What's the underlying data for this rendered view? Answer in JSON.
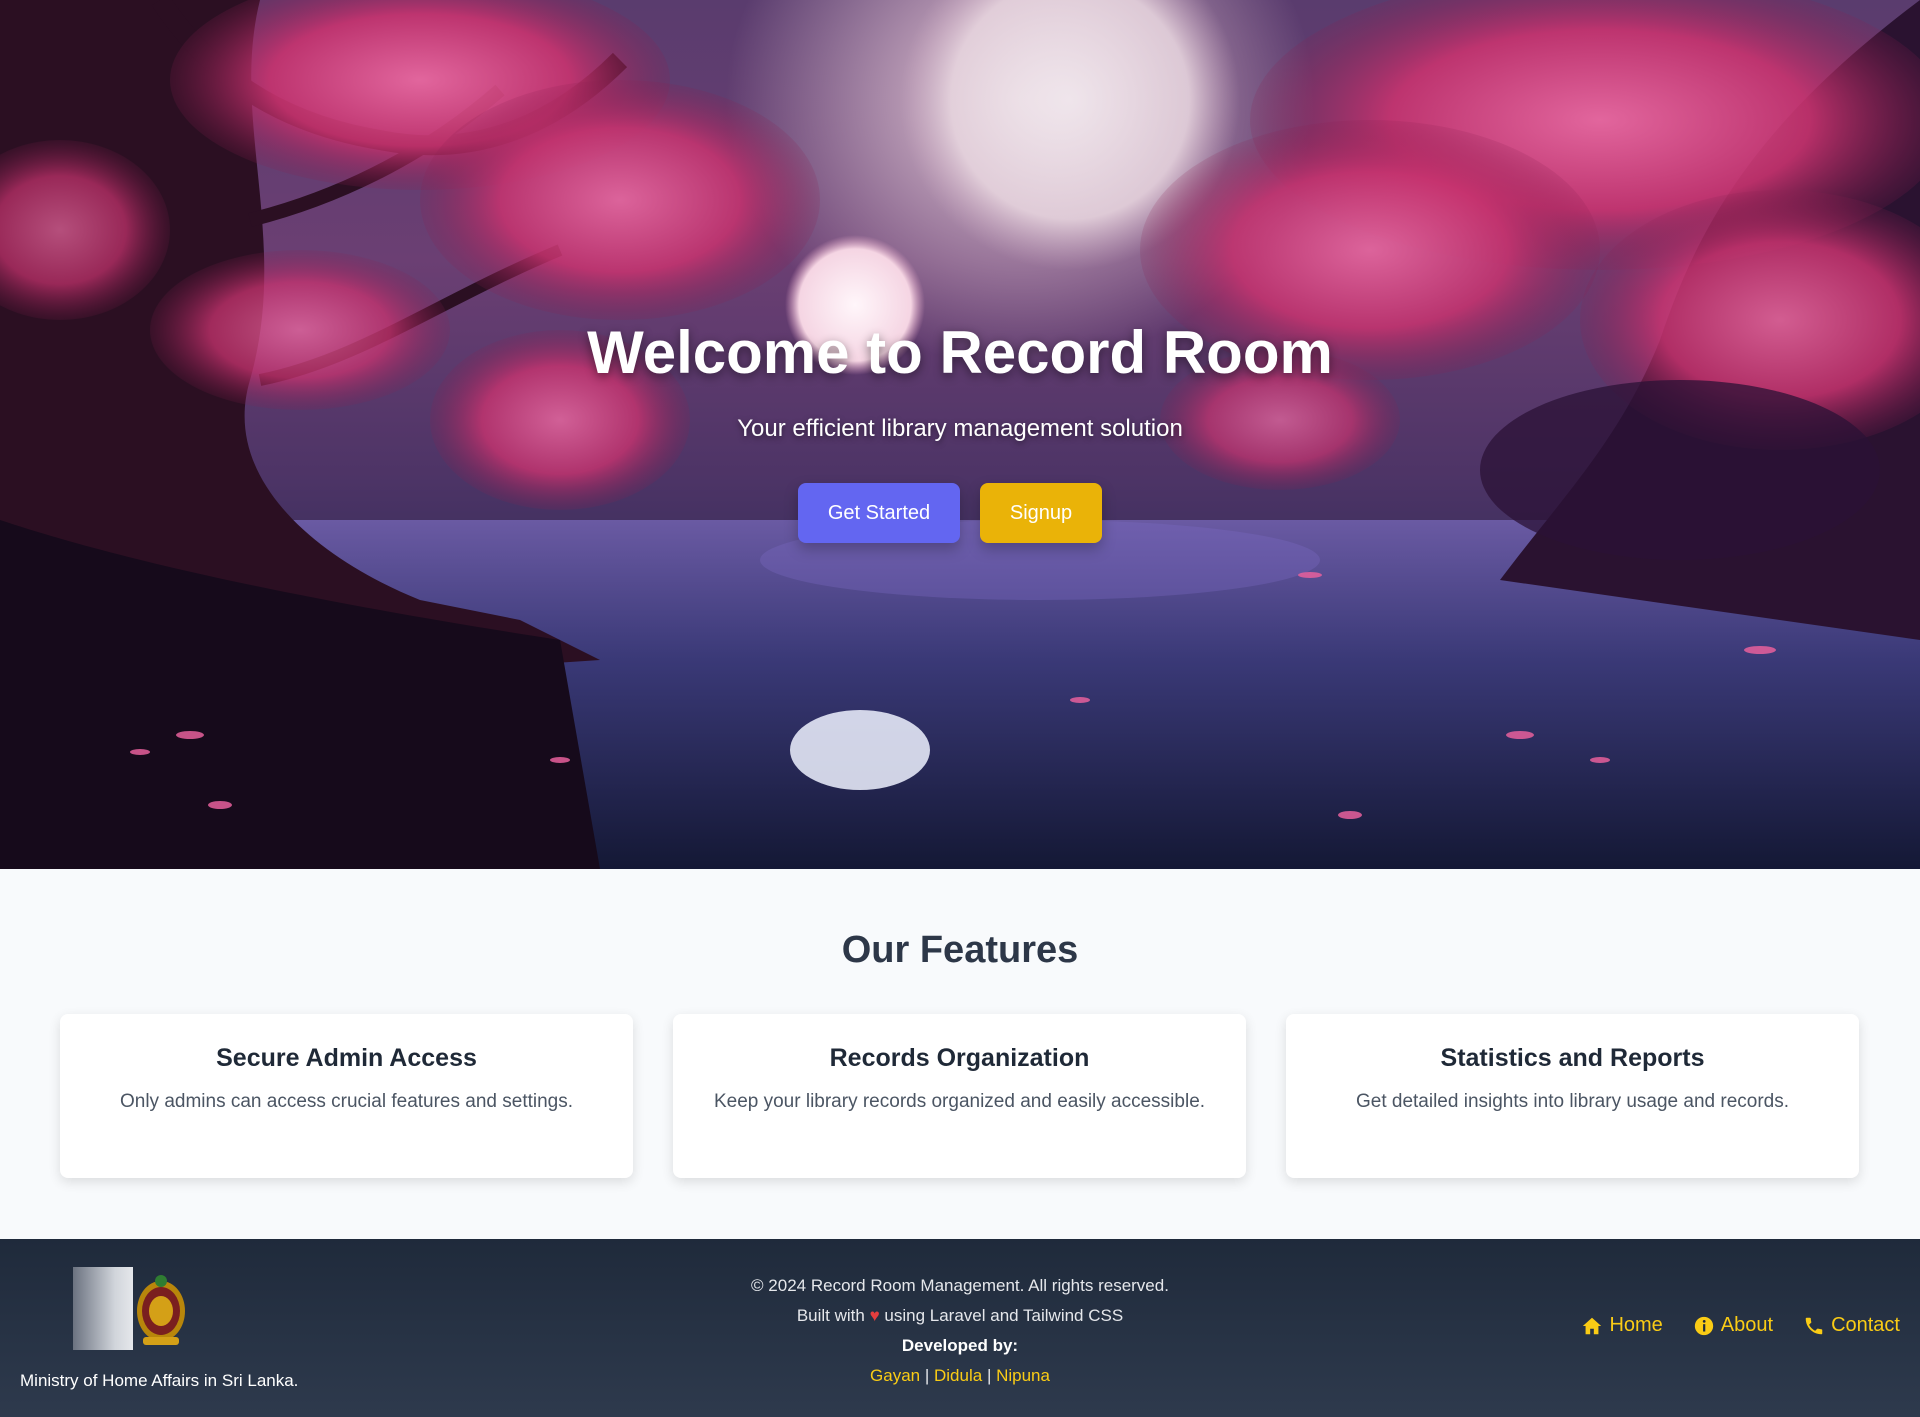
{
  "hero": {
    "title": "Welcome to Record Room",
    "subtitle": "Your efficient library management solution",
    "get_started_label": "Get Started",
    "signup_label": "Signup"
  },
  "features": {
    "title": "Our Features",
    "cards": [
      {
        "title": "Secure Admin Access",
        "description": "Only admins can access crucial features and settings."
      },
      {
        "title": "Records Organization",
        "description": "Keep your library records organized and easily accessible."
      },
      {
        "title": "Statistics and Reports",
        "description": "Get detailed insights into library usage and records."
      }
    ]
  },
  "footer": {
    "ministry": "Ministry of Home Affairs in Sri Lanka.",
    "copyright": "© 2024 Record Room Management. All rights reserved.",
    "built_prefix": "Built with",
    "built_suffix": "using Laravel and Tailwind CSS",
    "heart": "♥",
    "developed_by": "Developed by:",
    "developers": [
      "Gayan",
      "Didula",
      "Nipuna"
    ],
    "separator": "|",
    "nav": [
      {
        "label": "Home",
        "icon": "home-icon"
      },
      {
        "label": "About",
        "icon": "info-icon"
      },
      {
        "label": "Contact",
        "icon": "phone-icon"
      }
    ]
  },
  "colors": {
    "primary": "#6366f1",
    "warning": "#eab308",
    "footer_link": "#facc15",
    "footer_bg": "#1f2a3b"
  }
}
